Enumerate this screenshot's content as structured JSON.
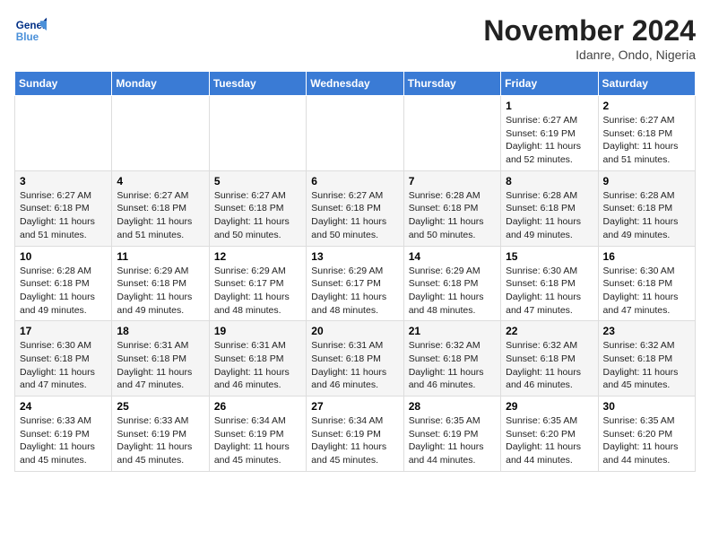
{
  "logo": {
    "line1": "General",
    "line2": "Blue"
  },
  "title": "November 2024",
  "location": "Idanre, Ondo, Nigeria",
  "days_of_week": [
    "Sunday",
    "Monday",
    "Tuesday",
    "Wednesday",
    "Thursday",
    "Friday",
    "Saturday"
  ],
  "weeks": [
    [
      {
        "day": "",
        "info": ""
      },
      {
        "day": "",
        "info": ""
      },
      {
        "day": "",
        "info": ""
      },
      {
        "day": "",
        "info": ""
      },
      {
        "day": "",
        "info": ""
      },
      {
        "day": "1",
        "info": "Sunrise: 6:27 AM\nSunset: 6:19 PM\nDaylight: 11 hours\nand 52 minutes."
      },
      {
        "day": "2",
        "info": "Sunrise: 6:27 AM\nSunset: 6:18 PM\nDaylight: 11 hours\nand 51 minutes."
      }
    ],
    [
      {
        "day": "3",
        "info": "Sunrise: 6:27 AM\nSunset: 6:18 PM\nDaylight: 11 hours\nand 51 minutes."
      },
      {
        "day": "4",
        "info": "Sunrise: 6:27 AM\nSunset: 6:18 PM\nDaylight: 11 hours\nand 51 minutes."
      },
      {
        "day": "5",
        "info": "Sunrise: 6:27 AM\nSunset: 6:18 PM\nDaylight: 11 hours\nand 50 minutes."
      },
      {
        "day": "6",
        "info": "Sunrise: 6:27 AM\nSunset: 6:18 PM\nDaylight: 11 hours\nand 50 minutes."
      },
      {
        "day": "7",
        "info": "Sunrise: 6:28 AM\nSunset: 6:18 PM\nDaylight: 11 hours\nand 50 minutes."
      },
      {
        "day": "8",
        "info": "Sunrise: 6:28 AM\nSunset: 6:18 PM\nDaylight: 11 hours\nand 49 minutes."
      },
      {
        "day": "9",
        "info": "Sunrise: 6:28 AM\nSunset: 6:18 PM\nDaylight: 11 hours\nand 49 minutes."
      }
    ],
    [
      {
        "day": "10",
        "info": "Sunrise: 6:28 AM\nSunset: 6:18 PM\nDaylight: 11 hours\nand 49 minutes."
      },
      {
        "day": "11",
        "info": "Sunrise: 6:29 AM\nSunset: 6:18 PM\nDaylight: 11 hours\nand 49 minutes."
      },
      {
        "day": "12",
        "info": "Sunrise: 6:29 AM\nSunset: 6:17 PM\nDaylight: 11 hours\nand 48 minutes."
      },
      {
        "day": "13",
        "info": "Sunrise: 6:29 AM\nSunset: 6:17 PM\nDaylight: 11 hours\nand 48 minutes."
      },
      {
        "day": "14",
        "info": "Sunrise: 6:29 AM\nSunset: 6:18 PM\nDaylight: 11 hours\nand 48 minutes."
      },
      {
        "day": "15",
        "info": "Sunrise: 6:30 AM\nSunset: 6:18 PM\nDaylight: 11 hours\nand 47 minutes."
      },
      {
        "day": "16",
        "info": "Sunrise: 6:30 AM\nSunset: 6:18 PM\nDaylight: 11 hours\nand 47 minutes."
      }
    ],
    [
      {
        "day": "17",
        "info": "Sunrise: 6:30 AM\nSunset: 6:18 PM\nDaylight: 11 hours\nand 47 minutes."
      },
      {
        "day": "18",
        "info": "Sunrise: 6:31 AM\nSunset: 6:18 PM\nDaylight: 11 hours\nand 47 minutes."
      },
      {
        "day": "19",
        "info": "Sunrise: 6:31 AM\nSunset: 6:18 PM\nDaylight: 11 hours\nand 46 minutes."
      },
      {
        "day": "20",
        "info": "Sunrise: 6:31 AM\nSunset: 6:18 PM\nDaylight: 11 hours\nand 46 minutes."
      },
      {
        "day": "21",
        "info": "Sunrise: 6:32 AM\nSunset: 6:18 PM\nDaylight: 11 hours\nand 46 minutes."
      },
      {
        "day": "22",
        "info": "Sunrise: 6:32 AM\nSunset: 6:18 PM\nDaylight: 11 hours\nand 46 minutes."
      },
      {
        "day": "23",
        "info": "Sunrise: 6:32 AM\nSunset: 6:18 PM\nDaylight: 11 hours\nand 45 minutes."
      }
    ],
    [
      {
        "day": "24",
        "info": "Sunrise: 6:33 AM\nSunset: 6:19 PM\nDaylight: 11 hours\nand 45 minutes."
      },
      {
        "day": "25",
        "info": "Sunrise: 6:33 AM\nSunset: 6:19 PM\nDaylight: 11 hours\nand 45 minutes."
      },
      {
        "day": "26",
        "info": "Sunrise: 6:34 AM\nSunset: 6:19 PM\nDaylight: 11 hours\nand 45 minutes."
      },
      {
        "day": "27",
        "info": "Sunrise: 6:34 AM\nSunset: 6:19 PM\nDaylight: 11 hours\nand 45 minutes."
      },
      {
        "day": "28",
        "info": "Sunrise: 6:35 AM\nSunset: 6:19 PM\nDaylight: 11 hours\nand 44 minutes."
      },
      {
        "day": "29",
        "info": "Sunrise: 6:35 AM\nSunset: 6:20 PM\nDaylight: 11 hours\nand 44 minutes."
      },
      {
        "day": "30",
        "info": "Sunrise: 6:35 AM\nSunset: 6:20 PM\nDaylight: 11 hours\nand 44 minutes."
      }
    ]
  ]
}
